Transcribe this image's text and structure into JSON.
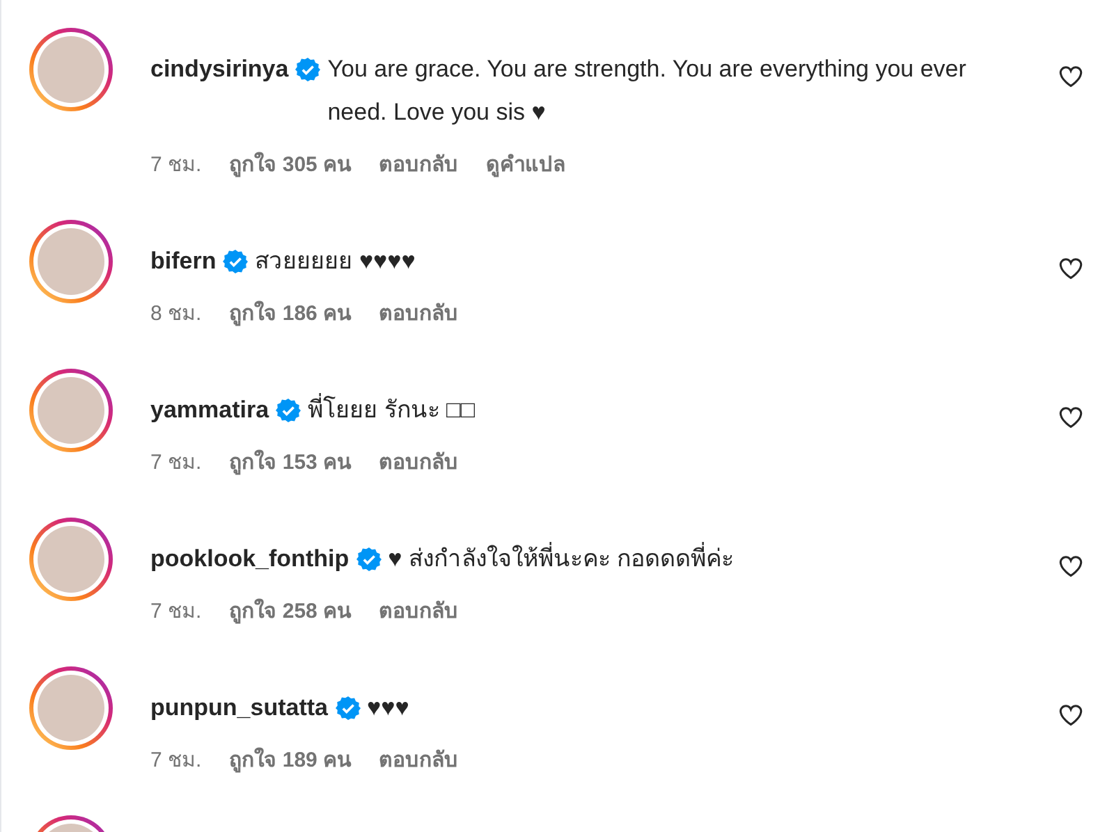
{
  "comments": [
    {
      "username": "cindysirinya",
      "verified": true,
      "text": "You are grace. You are strength. You are everything you ever need. Love you sis ♥",
      "time": "7 ชม.",
      "likes": "ถูกใจ 305 คน",
      "reply": "ตอบกลับ",
      "translate": "ดูคำแปล",
      "liked": false
    },
    {
      "username": "bifern",
      "verified": true,
      "text": "สวยยยยย ♥♥♥♥",
      "time": "8 ชม.",
      "likes": "ถูกใจ 186 คน",
      "reply": "ตอบกลับ",
      "liked": false
    },
    {
      "username": "yammatira",
      "verified": true,
      "text": "พี่โยยย รักนะ □□",
      "time": "7 ชม.",
      "likes": "ถูกใจ 153 คน",
      "reply": "ตอบกลับ",
      "liked": false
    },
    {
      "username": "pooklook_fonthip",
      "verified": true,
      "text": "♥ ส่งกำลังใจให้พี่นะคะ กอดดดพี่ค่ะ",
      "time": "7 ชม.",
      "likes": "ถูกใจ 258 คน",
      "reply": "ตอบกลับ",
      "liked": false
    },
    {
      "username": "punpun_sutatta",
      "verified": true,
      "text": "♥♥♥",
      "time": "7 ชม.",
      "likes": "ถูกใจ 189 คน",
      "reply": "ตอบกลับ",
      "liked": false
    }
  ],
  "more_below": true
}
